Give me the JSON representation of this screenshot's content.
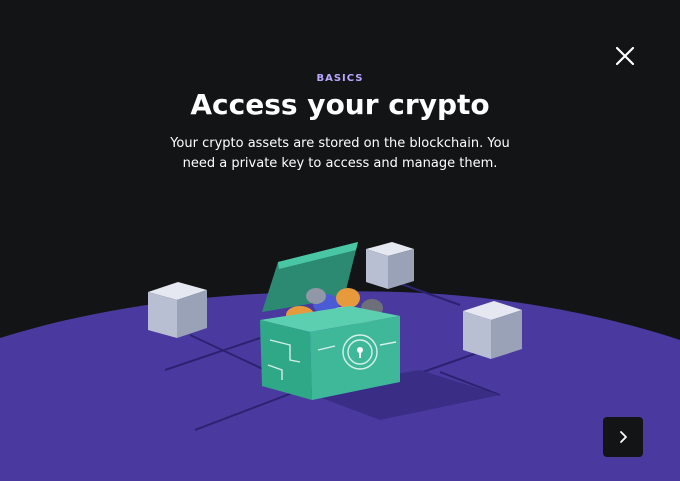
{
  "onboarding": {
    "eyebrow": "BASICS",
    "title": "Access your crypto",
    "description": "Your crypto assets are stored on the blockchain. You need a private key to access and manage them."
  },
  "icons": {
    "close": "close-icon",
    "next": "chevron-right-icon"
  },
  "colors": {
    "background": "#131416",
    "accent": "#bba7ff",
    "floor": "#4a3aa0",
    "chest": "#3fb89a"
  }
}
